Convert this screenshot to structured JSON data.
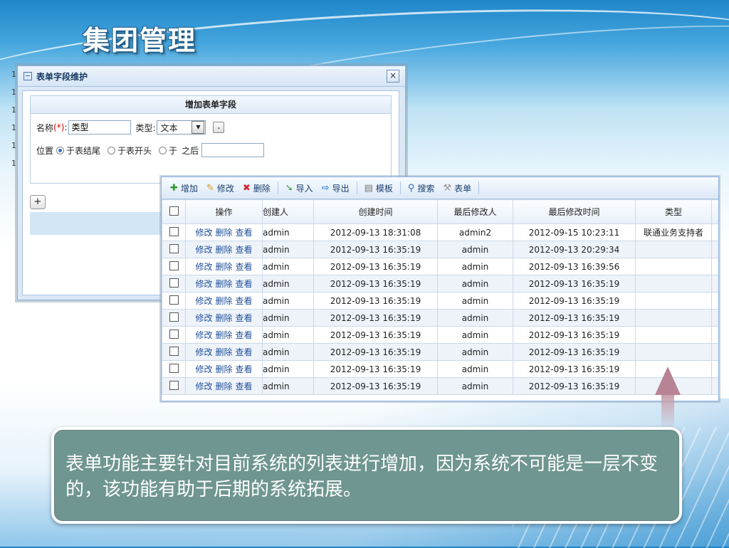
{
  "slide": {
    "title": "集团管理"
  },
  "back_rows": [
    "1",
    "1",
    "1",
    "1",
    "1",
    "1"
  ],
  "dialog": {
    "title": "表单字段维护",
    "close_glyph": "×",
    "panel_title": "增加表单字段",
    "name_label": "名称",
    "required_mark": "(*)",
    "colon": ":",
    "name_value": "类型",
    "type_label": "类型:",
    "type_value": "文本",
    "minus_label": "-",
    "position_label": "位置",
    "radio_end": "于表结尾",
    "radio_start": "于表开头",
    "radio_after_prefix": "于",
    "radio_after_suffix": "之后",
    "after_value": "",
    "add_label": "+"
  },
  "toolbar": {
    "add": "增加",
    "edit": "修改",
    "delete": "删除",
    "import": "导入",
    "export": "导出",
    "template": "模板",
    "search": "搜索",
    "form": "表单"
  },
  "grid": {
    "columns": [
      "操作",
      "创建人",
      "创建时间",
      "最后修改人",
      "最后修改时间",
      "类型"
    ],
    "actions": [
      "修改",
      "删除",
      "查看"
    ],
    "rows": [
      {
        "creator": "admin",
        "created": "2012-09-13 18:31:08",
        "modifier": "admin2",
        "modified": "2012-09-15 10:23:11",
        "type": "联通业务支持者"
      },
      {
        "creator": "admin",
        "created": "2012-09-13 16:35:19",
        "modifier": "admin",
        "modified": "2012-09-13 20:29:34",
        "type": ""
      },
      {
        "creator": "admin",
        "created": "2012-09-13 16:35:19",
        "modifier": "admin",
        "modified": "2012-09-13 16:39:56",
        "type": ""
      },
      {
        "creator": "admin",
        "created": "2012-09-13 16:35:19",
        "modifier": "admin",
        "modified": "2012-09-13 16:35:19",
        "type": ""
      },
      {
        "creator": "admin",
        "created": "2012-09-13 16:35:19",
        "modifier": "admin",
        "modified": "2012-09-13 16:35:19",
        "type": ""
      },
      {
        "creator": "admin",
        "created": "2012-09-13 16:35:19",
        "modifier": "admin",
        "modified": "2012-09-13 16:35:19",
        "type": ""
      },
      {
        "creator": "admin",
        "created": "2012-09-13 16:35:19",
        "modifier": "admin",
        "modified": "2012-09-13 16:35:19",
        "type": ""
      },
      {
        "creator": "admin",
        "created": "2012-09-13 16:35:19",
        "modifier": "admin",
        "modified": "2012-09-13 16:35:19",
        "type": ""
      },
      {
        "creator": "admin",
        "created": "2012-09-13 16:35:19",
        "modifier": "admin",
        "modified": "2012-09-13 16:35:19",
        "type": ""
      },
      {
        "creator": "admin",
        "created": "2012-09-13 16:35:19",
        "modifier": "admin",
        "modified": "2012-09-13 16:35:19",
        "type": ""
      }
    ]
  },
  "callout": {
    "text": "表单功能主要针对目前系统的列表进行增加，因为系统不可能是一层不变的，该功能有助于后期的系统拓展。"
  },
  "colors": {
    "callout_bg": "#6f9690",
    "arrow": "#b88394",
    "link": "#1f4f99"
  }
}
